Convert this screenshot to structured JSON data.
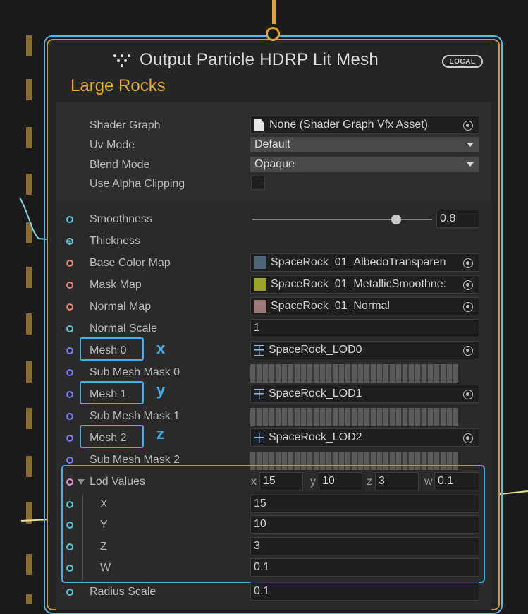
{
  "node": {
    "title": "Output Particle HDRP Lit Mesh",
    "badge": "LOCAL",
    "subtitle": "Large Rocks"
  },
  "settings": [
    {
      "label": "Shader Graph",
      "value": "None (Shader Graph Vfx Asset)"
    },
    {
      "label": "Uv Mode",
      "value": "Default"
    },
    {
      "label": "Blend Mode",
      "value": "Opaque"
    },
    {
      "label": "Use Alpha Clipping",
      "checked": false
    }
  ],
  "properties": {
    "smoothness": {
      "label": "Smoothness",
      "value": "0.8",
      "fraction": 0.8
    },
    "thickness": {
      "label": "Thickness"
    },
    "base_color_map": {
      "label": "Base Color Map",
      "value": "SpaceRock_01_AlbedoTransparen"
    },
    "mask_map": {
      "label": "Mask Map",
      "value": "SpaceRock_01_MetallicSmoothne:"
    },
    "normal_map": {
      "label": "Normal Map",
      "value": "SpaceRock_01_Normal"
    },
    "normal_scale": {
      "label": "Normal Scale",
      "value": "1"
    },
    "mesh0": {
      "label": "Mesh 0",
      "value": "SpaceRock_LOD0",
      "annotation": "x"
    },
    "submask0": {
      "label": "Sub Mesh Mask 0"
    },
    "mesh1": {
      "label": "Mesh 1",
      "value": "SpaceRock_LOD1",
      "annotation": "y"
    },
    "submask1": {
      "label": "Sub Mesh Mask 1"
    },
    "mesh2": {
      "label": "Mesh 2",
      "value": "SpaceRock_LOD2",
      "annotation": "z"
    },
    "submask2": {
      "label": "Sub Mesh Mask 2"
    },
    "lod_values": {
      "label": "Lod Values",
      "x_label": "x",
      "x": "15",
      "y_label": "y",
      "y": "10",
      "z_label": "z",
      "z": "3",
      "w_label": "w",
      "w": "0.1"
    },
    "lod_x": {
      "label": "X",
      "value": "15"
    },
    "lod_y": {
      "label": "Y",
      "value": "10"
    },
    "lod_z": {
      "label": "Z",
      "value": "3"
    },
    "lod_w": {
      "label": "W",
      "value": "0.1"
    },
    "radius_scale": {
      "label": "Radius Scale",
      "value": "0.1"
    }
  },
  "colors": {
    "selection": "#59b6e6",
    "title_accent": "#e8ac2f",
    "port_float": "#62c8d8",
    "port_texture": "#e5877b",
    "port_mesh": "#7d7ef0",
    "annotation": "#3fb2ea"
  },
  "icons": [
    "vfx-output-icon",
    "document-icon",
    "object-picker-icon",
    "mesh-icon",
    "texture-thumbnail"
  ]
}
